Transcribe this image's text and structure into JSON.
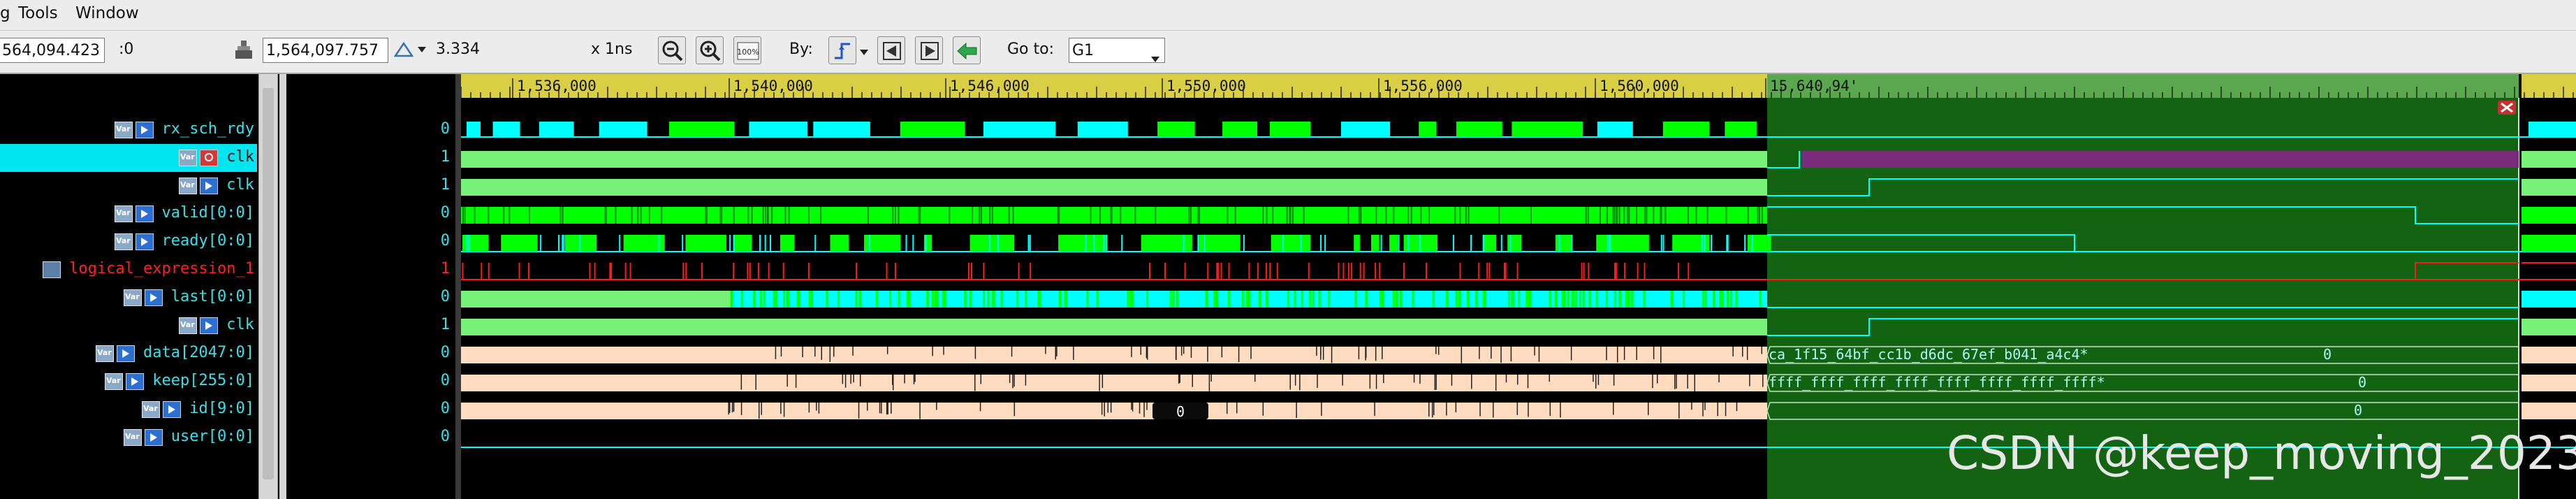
{
  "menubar": {
    "items": [
      "g",
      "Tools",
      "Window"
    ]
  },
  "toolbar": {
    "time_field": "564,094.423",
    "time_suffix": ":0",
    "cursor_time": "1,564,097.757",
    "delta_value": "3.334",
    "scale": "x 1ns",
    "by_label": "By:",
    "goto_label": "Go to:",
    "goto_value": "G1",
    "zoom_full_label": "100%"
  },
  "ruler": {
    "labels": [
      "1,536,000",
      "1,540,000",
      "1,546,000",
      "1,550,000",
      "1,556,000",
      "1,560,000",
      "15,640,94'"
    ]
  },
  "signals": [
    {
      "name": "rx_sch_rdy",
      "value": "0",
      "icons": [
        "var",
        "port"
      ]
    },
    {
      "name": "clk",
      "value": "1",
      "icons": [
        "var",
        "red"
      ],
      "selected": true
    },
    {
      "name": "clk",
      "value": "1",
      "icons": [
        "var",
        "port"
      ]
    },
    {
      "name": "valid[0:0]",
      "value": "0",
      "icons": [
        "var",
        "port"
      ]
    },
    {
      "name": "ready[0:0]",
      "value": "0",
      "icons": [
        "var",
        "port"
      ]
    },
    {
      "name": "logical_expression_1",
      "value": "1",
      "icons": [
        "expr"
      ],
      "red": true
    },
    {
      "name": "last[0:0]",
      "value": "0",
      "icons": [
        "var",
        "port"
      ]
    },
    {
      "name": "clk",
      "value": "1",
      "icons": [
        "var",
        "port"
      ]
    },
    {
      "name": "data[2047:0]",
      "value": "0",
      "icons": [
        "var",
        "port"
      ]
    },
    {
      "name": "keep[255:0]",
      "value": "0",
      "icons": [
        "var",
        "port"
      ]
    },
    {
      "name": "id[9:0]",
      "value": "0",
      "icons": [
        "var",
        "port"
      ]
    },
    {
      "name": "user[0:0]",
      "value": "0",
      "icons": [
        "var",
        "port"
      ]
    }
  ],
  "wave_text": {
    "data_value": "ca_1f15_64bf_cc1b_d6dc_67ef_b041_a4c4*",
    "data_zero": "0",
    "keep_value": "ffff_ffff_ffff_ffff_ffff_ffff_ffff_ffff*",
    "keep_zero": "0",
    "id_zero": "0",
    "id_value": "0",
    "id_right_zero": "0"
  },
  "colors": {
    "wave_green": "#00ff00",
    "wave_cyan": "#00ffff",
    "clock_fill": "#79f279",
    "bus_fill": "#ffdcc0",
    "selection_region": "#136313",
    "purple": "#7b2b7b",
    "red_trace": "#ff1a1a"
  },
  "watermark": "CSDN @keep_moving_2023"
}
